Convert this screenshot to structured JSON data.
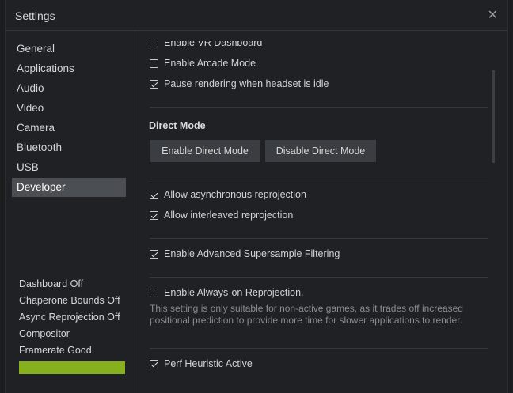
{
  "window": {
    "title": "Settings"
  },
  "sidebar": {
    "items": [
      {
        "label": "General"
      },
      {
        "label": "Applications"
      },
      {
        "label": "Audio"
      },
      {
        "label": "Video"
      },
      {
        "label": "Camera"
      },
      {
        "label": "Bluetooth"
      },
      {
        "label": "USB"
      },
      {
        "label": "Developer",
        "active": true
      }
    ]
  },
  "status": {
    "dashboard": "Dashboard Off",
    "chaperone": "Chaperone Bounds Off",
    "async": "Async Reprojection Off",
    "compositor": "Compositor",
    "framerate": "Framerate Good",
    "framerate_color": "#86b01c"
  },
  "content": {
    "enable_vr_dashboard": {
      "label": "Enable VR Dashboard",
      "checked": false
    },
    "enable_arcade_mode": {
      "label": "Enable Arcade Mode",
      "checked": false
    },
    "pause_rendering": {
      "label": "Pause rendering when headset is idle",
      "checked": true
    },
    "direct_mode": {
      "title": "Direct Mode",
      "enable_label": "Enable Direct Mode",
      "disable_label": "Disable Direct Mode"
    },
    "allow_async": {
      "label": "Allow asynchronous reprojection",
      "checked": true
    },
    "allow_interleaved": {
      "label": "Allow interleaved reprojection",
      "checked": true
    },
    "supersample": {
      "label": "Enable Advanced Supersample Filtering",
      "checked": true
    },
    "always_on_reprojection": {
      "label": "Enable Always-on Reprojection.",
      "checked": false,
      "description": "This setting is only suitable for non-active games, as it trades off increased positional prediction to provide more time for slower applications to render."
    },
    "perf_heuristic": {
      "label": "Perf Heuristic Active",
      "checked": true
    }
  }
}
